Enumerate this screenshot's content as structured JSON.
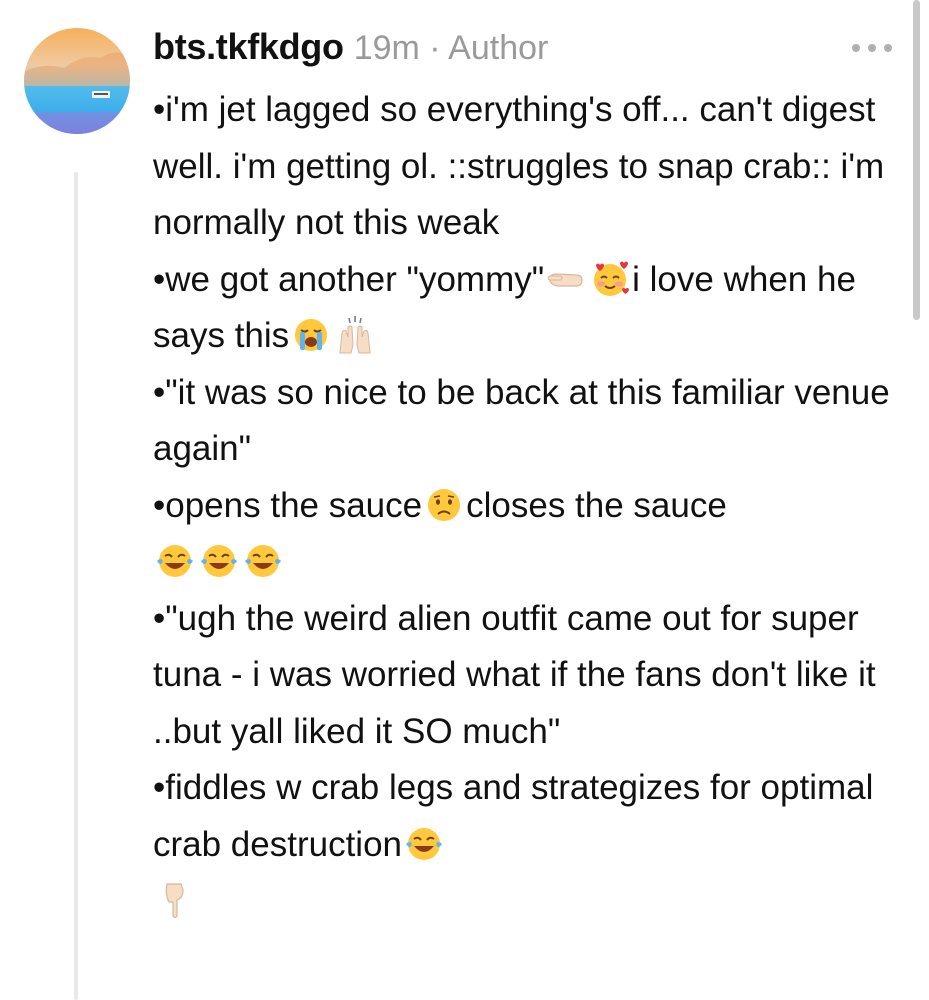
{
  "post": {
    "username": "bts.tkfkdgo",
    "meta": "19m · Author",
    "more_icon": "ellipsis-icon",
    "paragraphs": {
      "p1": "•i'm jet lagged so everything's off... can't digest well. i'm getting ol. ::struggles to snap crab:: i'm normally not this weak",
      "p2a": "•we got another \"yommy\"",
      "p2b": "i love when he says this",
      "p3": "•\"it was so nice to be back at this familiar venue again\"",
      "p4a": "•opens the sauce",
      "p4b": "closes the sauce",
      "p5": "•\"ugh the weird alien outfit came out for super tuna - i was worried what if the fans don't like it ..but yall liked it SO much\"",
      "p6": "•fiddles w crab legs and strategizes for optimal crab destruction"
    }
  },
  "colors": {
    "text": "#111111",
    "meta": "#9a9a9a",
    "thread_line": "#e8e8e8"
  }
}
